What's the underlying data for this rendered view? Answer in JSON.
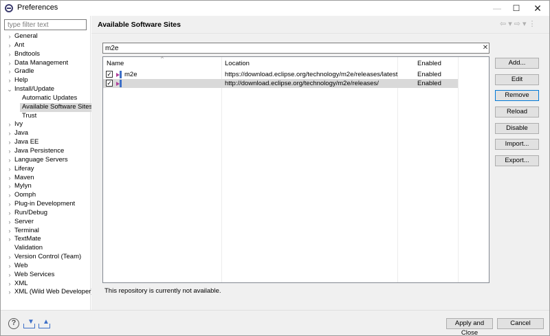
{
  "window": {
    "title": "Preferences",
    "icon": "eclipse-icon",
    "controls": {
      "minimize": "—",
      "maximize": "☐",
      "close": "✕"
    }
  },
  "filter": {
    "placeholder": "type filter text",
    "value": ""
  },
  "tree": [
    {
      "label": "General",
      "expander": "›",
      "level": 0
    },
    {
      "label": "Ant",
      "expander": "›",
      "level": 0
    },
    {
      "label": "Bndtools",
      "expander": "›",
      "level": 0
    },
    {
      "label": "Data Management",
      "expander": "›",
      "level": 0
    },
    {
      "label": "Gradle",
      "expander": "›",
      "level": 0
    },
    {
      "label": "Help",
      "expander": "›",
      "level": 0
    },
    {
      "label": "Install/Update",
      "expander": "⌄",
      "level": 0
    },
    {
      "label": "Automatic Updates",
      "expander": "",
      "level": 1
    },
    {
      "label": "Available Software Sites",
      "expander": "",
      "level": 1,
      "selected": true
    },
    {
      "label": "Trust",
      "expander": "",
      "level": 1
    },
    {
      "label": "Ivy",
      "expander": "›",
      "level": 0
    },
    {
      "label": "Java",
      "expander": "›",
      "level": 0
    },
    {
      "label": "Java EE",
      "expander": "›",
      "level": 0
    },
    {
      "label": "Java Persistence",
      "expander": "›",
      "level": 0
    },
    {
      "label": "Language Servers",
      "expander": "›",
      "level": 0
    },
    {
      "label": "Liferay",
      "expander": "›",
      "level": 0
    },
    {
      "label": "Maven",
      "expander": "›",
      "level": 0
    },
    {
      "label": "Mylyn",
      "expander": "›",
      "level": 0
    },
    {
      "label": "Oomph",
      "expander": "›",
      "level": 0
    },
    {
      "label": "Plug-in Development",
      "expander": "›",
      "level": 0
    },
    {
      "label": "Run/Debug",
      "expander": "›",
      "level": 0
    },
    {
      "label": "Server",
      "expander": "›",
      "level": 0
    },
    {
      "label": "Terminal",
      "expander": "›",
      "level": 0
    },
    {
      "label": "TextMate",
      "expander": "›",
      "level": 0
    },
    {
      "label": "Validation",
      "expander": "",
      "level": 0
    },
    {
      "label": "Version Control (Team)",
      "expander": "›",
      "level": 0
    },
    {
      "label": "Web",
      "expander": "›",
      "level": 0
    },
    {
      "label": "Web Services",
      "expander": "›",
      "level": 0
    },
    {
      "label": "XML",
      "expander": "›",
      "level": 0
    },
    {
      "label": "XML (Wild Web Developer)",
      "expander": "›",
      "level": 0
    }
  ],
  "page": {
    "title": "Available Software Sites",
    "nav": {
      "back": "⇦",
      "back_menu": "▾",
      "forward": "⇨",
      "forward_menu": "▾",
      "more": "⋮"
    }
  },
  "search": {
    "value": "m2e",
    "clear": "✕"
  },
  "table": {
    "columns": {
      "name": "Name",
      "location": "Location",
      "enabled": "Enabled"
    },
    "sort_indicator": "^",
    "rows": [
      {
        "checked": "✓",
        "name": "m2e",
        "location": "https://download.eclipse.org/technology/m2e/releases/latest",
        "enabled": "Enabled",
        "selected": false
      },
      {
        "checked": "✓",
        "name": "",
        "location": "http://download.eclipse.org/technology/m2e/releases/",
        "enabled": "Enabled",
        "selected": true
      }
    ]
  },
  "status_message": "This repository is currently not available.",
  "buttons": {
    "add": "Add...",
    "edit": "Edit",
    "remove": "Remove",
    "reload": "Reload",
    "disable": "Disable",
    "import": "Import...",
    "export": "Export..."
  },
  "footer": {
    "help": "?",
    "apply_close": "Apply and Close",
    "cancel": "Cancel"
  }
}
